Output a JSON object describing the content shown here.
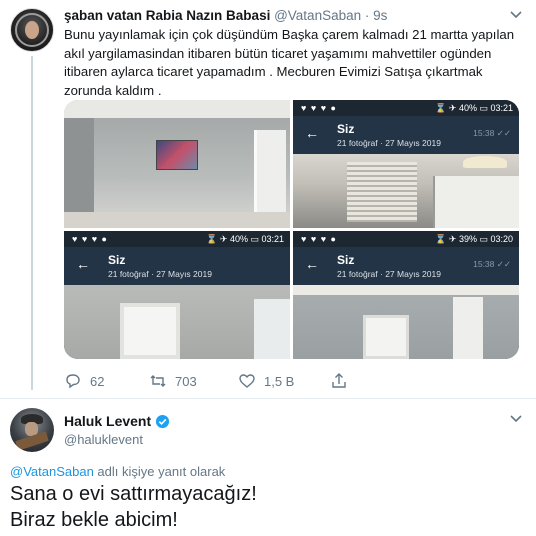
{
  "tweet": {
    "author_name": "şaban vatan Rabia Nazın Babasi",
    "handle": "@VatanSaban",
    "separator": "·",
    "time": "9s",
    "text": "Bunu yayınlamak için çok düşündüm Başka çarem kalmadı 21 martta yapılan akıl yargilamasindan itibaren bütün ticaret yaşamımı mahvettiler ogünden itibaren aylarca ticaret yapamadım . Mecburen Evimizi Satışa çıkartmak zorunda kaldım .",
    "photos": [
      {
        "id": "room-living"
      },
      {
        "status_left": "♥ ♥ ♥ ●",
        "status_right": "⌛ ✈ 40% ▭ 03:21",
        "title": "Siz",
        "subtitle": "21 fotoğraf · 27 Mayıs 2019",
        "stamp": "15:38 ✓✓"
      },
      {
        "status_left": "♥ ♥ ♥ ●",
        "status_right": "⌛ ✈ 40% ▭ 03:21",
        "title": "Siz",
        "subtitle": "21 fotoğraf · 27 Mayıs 2019",
        "stamp": ""
      },
      {
        "status_left": "♥ ♥ ♥ ●",
        "status_right": "⌛ ✈ 39% ▭ 03:20",
        "title": "Siz",
        "subtitle": "21 fotoğraf · 27 Mayıs 2019",
        "stamp": "15:38 ✓✓"
      }
    ],
    "actions": {
      "replies": "62",
      "retweets": "703",
      "likes": "1,5 B"
    }
  },
  "reply_tweet": {
    "author_name": "Haluk Levent",
    "handle": "@haluklevent",
    "reply_to_handle": "@VatanSaban",
    "reply_to_suffix": " adlı kişiye yanıt olarak",
    "line1": "Sana o evi sattırmayacağız!",
    "line2": "Biraz bekle abicim!"
  },
  "colors": {
    "link": "#1b95e0",
    "muted": "#657786",
    "verified": "#1da1f2"
  },
  "icons": [
    "chevron-down-icon",
    "reply-icon",
    "retweet-icon",
    "like-icon",
    "share-icon",
    "verified-icon",
    "back-arrow-icon"
  ]
}
